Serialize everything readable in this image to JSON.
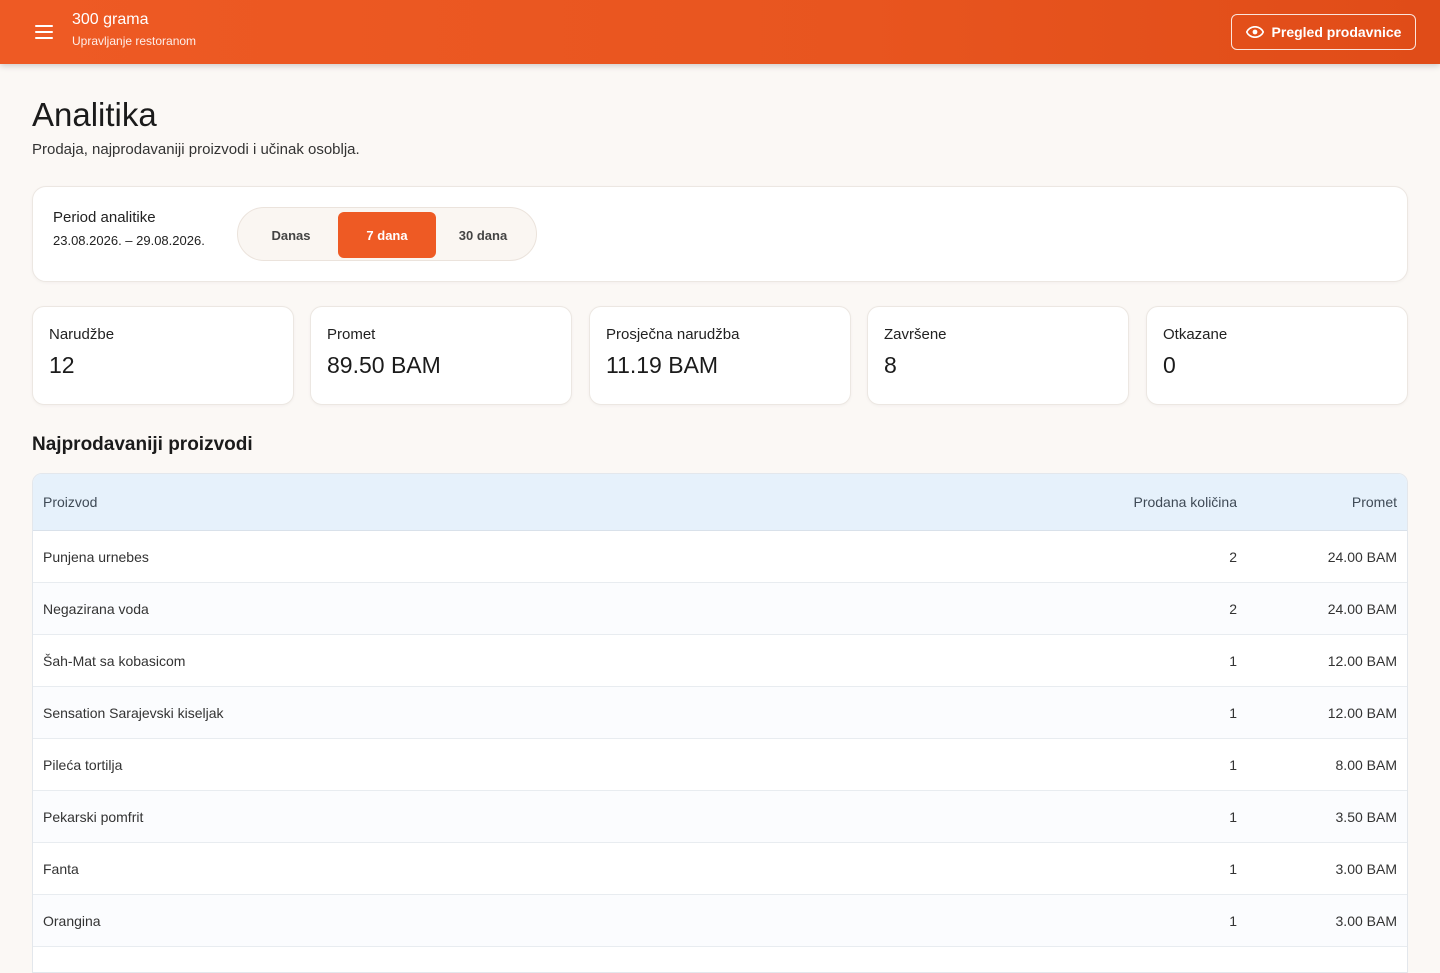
{
  "header": {
    "app_name": "300 grama",
    "app_subtitle": "Upravljanje restoranom",
    "preview_label": "Pregled prodavnice",
    "icons": {
      "menu": "menu-icon",
      "preview": "eye-icon"
    },
    "accent_color": "#ee5a24"
  },
  "page": {
    "title": "Analitika",
    "subtitle": "Prodaja, najprodavaniji proizvodi i učinak osoblja."
  },
  "period": {
    "label": "Period analitike",
    "range": "23.08.2026. – 29.08.2026.",
    "options": [
      "Danas",
      "7 dana",
      "30 dana"
    ],
    "selected": "7 dana"
  },
  "stats": [
    {
      "label": "Narudžbe",
      "value": "12"
    },
    {
      "label": "Promet",
      "value": "89.50 BAM"
    },
    {
      "label": "Prosječna narudžba",
      "value": "11.19 BAM"
    },
    {
      "label": "Završene",
      "value": "8"
    },
    {
      "label": "Otkazane",
      "value": "0"
    }
  ],
  "top_products": {
    "title": "Najprodavaniji proizvodi",
    "columns": {
      "product": "Proizvod",
      "qty": "Prodana količina",
      "revenue": "Promet"
    },
    "rows": [
      {
        "product": "Punjena urnebes",
        "qty": "2",
        "revenue": "24.00 BAM"
      },
      {
        "product": "Negazirana voda",
        "qty": "2",
        "revenue": "24.00 BAM"
      },
      {
        "product": "Šah-Mat sa kobasicom",
        "qty": "1",
        "revenue": "12.00 BAM"
      },
      {
        "product": "Sensation Sarajevski kiseljak",
        "qty": "1",
        "revenue": "12.00 BAM"
      },
      {
        "product": "Pileća tortilja",
        "qty": "1",
        "revenue": "8.00 BAM"
      },
      {
        "product": "Pekarski pomfrit",
        "qty": "1",
        "revenue": "3.50 BAM"
      },
      {
        "product": "Fanta",
        "qty": "1",
        "revenue": "3.00 BAM"
      },
      {
        "product": "Orangina",
        "qty": "1",
        "revenue": "3.00 BAM"
      }
    ]
  }
}
